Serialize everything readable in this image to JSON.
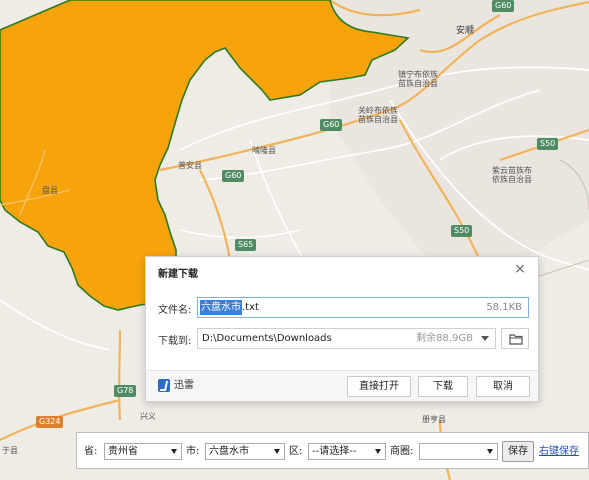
{
  "map": {
    "region_color": "#f7a30c",
    "region_border": "#2c7a1f",
    "places": [
      {
        "id": "anshun",
        "text": "安顺"
      },
      {
        "id": "zhenning",
        "text": "镇宁布依族\n苗族自治县"
      },
      {
        "id": "guanling",
        "text": "关岭布依族\n苗族自治县"
      },
      {
        "id": "qinglong",
        "text": "晴隆县"
      },
      {
        "id": "puan",
        "text": "普安县"
      },
      {
        "id": "ziyun",
        "text": "紫云苗族布\n依族自治县"
      },
      {
        "id": "panxian",
        "text": "盘县"
      },
      {
        "id": "ceheng",
        "text": "册亨县"
      },
      {
        "id": "xingyi",
        "text": "兴义"
      },
      {
        "id": "yu",
        "text": "于县"
      }
    ],
    "shields": [
      {
        "id": "g60a",
        "text": "G60"
      },
      {
        "id": "g60b",
        "text": "G60"
      },
      {
        "id": "g60c",
        "text": "G60"
      },
      {
        "id": "s65",
        "text": "S65"
      },
      {
        "id": "s50a",
        "text": "S50"
      },
      {
        "id": "s50b",
        "text": "S50"
      },
      {
        "id": "g78",
        "text": "G78"
      },
      {
        "id": "g324",
        "text": "G324"
      }
    ]
  },
  "dialog": {
    "title": "新建下载",
    "close_icon": "×",
    "filename_label": "文件名:",
    "filename_selected": "六盘水市",
    "filename_ext": ".txt",
    "file_size": "58.1KB",
    "saveto_label": "下载到:",
    "save_path": "D:\\Documents\\Downloads",
    "free_space": "剩余88.9GB",
    "app_name": "迅雷",
    "btn_open": "直接打开",
    "btn_download": "下载",
    "btn_cancel": "取消"
  },
  "bar": {
    "province_label": "省:",
    "province_value": "贵州省",
    "city_label": "市:",
    "city_value": "六盘水市",
    "district_label": "区:",
    "district_value": "--请选择--",
    "circle_label": "商圈:",
    "circle_value": "",
    "save_label": "保存",
    "right_save_label": "右键保存"
  }
}
